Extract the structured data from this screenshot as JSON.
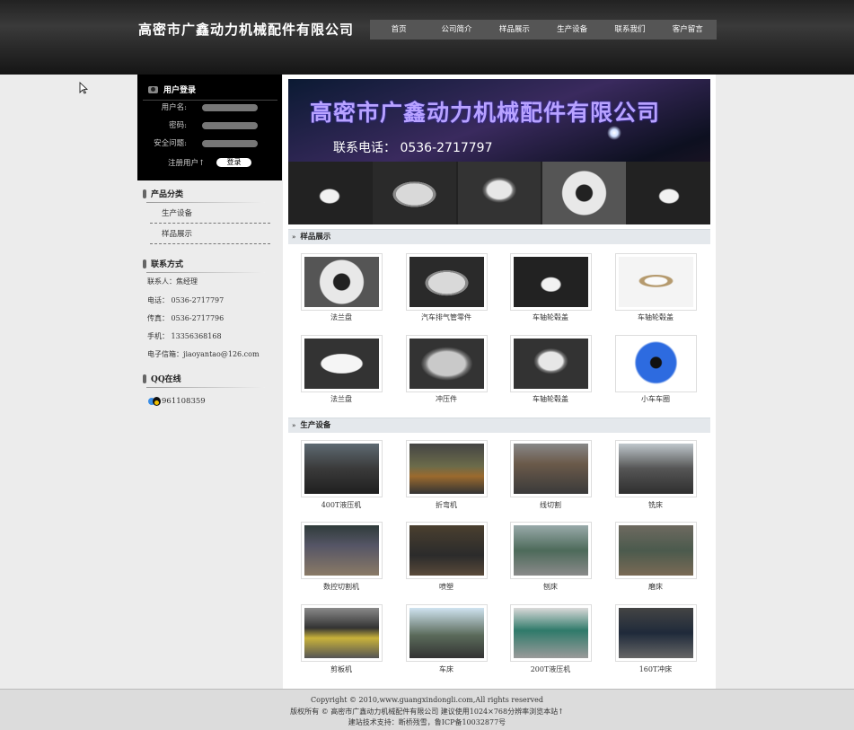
{
  "header": {
    "site_title": "高密市广鑫动力机械配件有限公司",
    "nav": [
      "首页",
      "公司简介",
      "样品展示",
      "生产设备",
      "联系我们",
      "客户留言"
    ]
  },
  "login": {
    "title": "用户登录",
    "username_label": "用户名:",
    "password_label": "密码:",
    "question_label": "安全问题:",
    "register_label": "注册用户↑",
    "login_button": "登录"
  },
  "categories": {
    "title": "产品分类",
    "items": [
      "生产设备",
      "样品展示"
    ]
  },
  "contact": {
    "title": "联系方式",
    "lines": [
      "联系人：焦经理",
      "电话： 0536-2717797",
      "传真： 0536-2717796",
      "手机： 13356368168",
      "电子信箱：jiaoyantao@126.com"
    ]
  },
  "qq": {
    "title": "QQ在线",
    "number": "961108359"
  },
  "banner": {
    "title": "高密市广鑫动力机械配件有限公司",
    "phone": "联系电话： 0536-2717797"
  },
  "samples": {
    "title": "样品展示",
    "items": [
      "法兰盘",
      "汽车排气管零件",
      "车轴轮毂盖",
      "车轴轮毂盖",
      "法兰盘",
      "冲压件",
      "车轴轮毂盖",
      "小车车圈"
    ]
  },
  "equipment": {
    "title": "生产设备",
    "items": [
      "400T液压机",
      "折弯机",
      "线切割",
      "铣床",
      "数控切割机",
      "喷塑",
      "刨床",
      "磨床",
      "剪板机",
      "车床",
      "200T液压机",
      "160T冲床"
    ]
  },
  "footer": {
    "copyright": "Copyright © 2010,www.guangxindongli.com,All rights reserved",
    "rights": "版权所有 © 高密市广鑫动力机械配件有限公司 建议使用1024×768分辨率浏览本站↑",
    "support": "建站技术支持：断桥残雪，鲁ICP备10032877号"
  }
}
